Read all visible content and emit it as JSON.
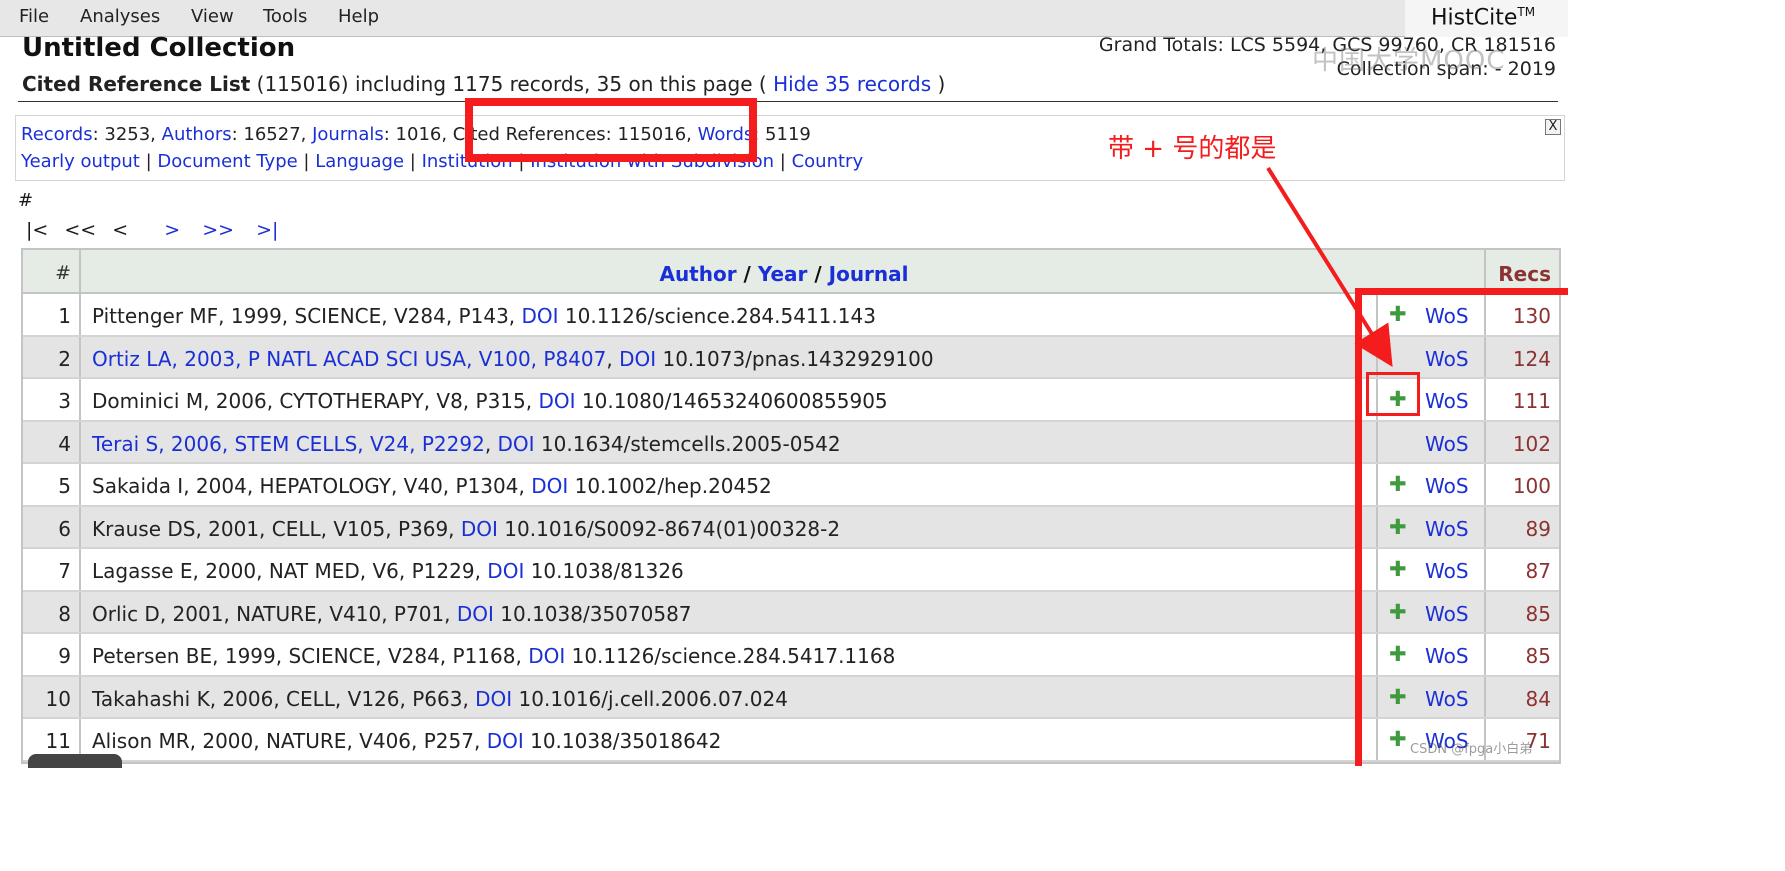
{
  "menu": [
    "File",
    "Analyses",
    "View",
    "Tools",
    "Help"
  ],
  "brand": {
    "name": "HistCite",
    "tm": "TM"
  },
  "collection": {
    "title": "Untitled Collection",
    "grand_totals": "Grand Totals: LCS 5594, GCS 99760, CR 181516",
    "span": "Collection span: - 2019",
    "list_name": "Cited Reference List",
    "list_detail": "(115016) including 1175 records, 35 on this page (",
    "hide_link": "Hide 35 records",
    "close_paren": ")"
  },
  "watermark": "中国大学MOOC",
  "stats": {
    "records_label": "Records",
    "records_value": ": 3253, ",
    "authors_label": "Authors",
    "authors_value": ": 16527, ",
    "journals_label": "Journals",
    "journals_value": ": 1016, ",
    "cited_text": "Cited References: 115016, ",
    "words_label": "Words",
    "words_value": ": 5119"
  },
  "quick_links": [
    "Yearly output",
    "Document Type",
    "Language",
    "Institution",
    "Institution with Subdivision",
    "Country"
  ],
  "close_label": "X",
  "hash": "#",
  "pager": {
    "first": "|<",
    "prev_page": "<<",
    "prev": "<",
    "next": ">",
    "next_page": ">>",
    "last": ">|"
  },
  "table": {
    "col_num": "#",
    "col_author": "Author",
    "col_year": "Year",
    "col_journal": "Journal",
    "sep": " / ",
    "col_recs": "Recs",
    "rows": [
      {
        "n": "1",
        "ref": "Pittenger MF, 1999, SCIENCE, V284, P143, ",
        "ref_link": "",
        "doi": "DOI",
        "doi_value": " 10.1126/science.284.5411.143",
        "plus": "✚",
        "wos": "WoS",
        "recs": "130"
      },
      {
        "n": "2",
        "ref": "",
        "ref_link": "Ortiz LA, 2003, P NATL ACAD SCI USA, V100, P8407",
        "doi": "DOI",
        "doi_value": " 10.1073/pnas.1432929100",
        "plus": "",
        "wos": "WoS",
        "recs": "124"
      },
      {
        "n": "3",
        "ref": "Dominici M, 2006, CYTOTHERAPY, V8, P315, ",
        "ref_link": "",
        "doi": "DOI",
        "doi_value": " 10.1080/14653240600855905",
        "plus": "✚",
        "wos": "WoS",
        "recs": "111"
      },
      {
        "n": "4",
        "ref": "",
        "ref_link": "Terai S, 2006, STEM CELLS, V24, P2292",
        "doi": "DOI",
        "doi_value": " 10.1634/stemcells.2005-0542",
        "plus": "",
        "wos": "WoS",
        "recs": "102"
      },
      {
        "n": "5",
        "ref": "Sakaida I, 2004, HEPATOLOGY, V40, P1304, ",
        "ref_link": "",
        "doi": "DOI",
        "doi_value": " 10.1002/hep.20452",
        "plus": "✚",
        "wos": "WoS",
        "recs": "100"
      },
      {
        "n": "6",
        "ref": "Krause DS, 2001, CELL, V105, P369, ",
        "ref_link": "",
        "doi": "DOI",
        "doi_value": " 10.1016/S0092-8674(01)00328-2",
        "plus": "✚",
        "wos": "WoS",
        "recs": "89"
      },
      {
        "n": "7",
        "ref": "Lagasse E, 2000, NAT MED, V6, P1229, ",
        "ref_link": "",
        "doi": "DOI",
        "doi_value": " 10.1038/81326",
        "plus": "✚",
        "wos": "WoS",
        "recs": "87"
      },
      {
        "n": "8",
        "ref": "Orlic D, 2001, NATURE, V410, P701, ",
        "ref_link": "",
        "doi": "DOI",
        "doi_value": " 10.1038/35070587",
        "plus": "✚",
        "wos": "WoS",
        "recs": "85"
      },
      {
        "n": "9",
        "ref": "Petersen BE, 1999, SCIENCE, V284, P1168, ",
        "ref_link": "",
        "doi": "DOI",
        "doi_value": " 10.1126/science.284.5417.1168",
        "plus": "✚",
        "wos": "WoS",
        "recs": "85"
      },
      {
        "n": "10",
        "ref": "Takahashi K, 2006, CELL, V126, P663, ",
        "ref_link": "",
        "doi": "DOI",
        "doi_value": " 10.1016/j.cell.2006.07.024",
        "plus": "✚",
        "wos": "WoS",
        "recs": "84"
      },
      {
        "n": "11",
        "ref": "Alison MR, 2000, NATURE, V406, P257, ",
        "ref_link": "",
        "doi": "DOI",
        "doi_value": " 10.1038/35018642",
        "plus": "✚",
        "wos": "WoS",
        "recs": "71"
      }
    ]
  },
  "annotation": {
    "text": "带 + 号的都是",
    "color": "#f41c1c"
  },
  "footer_watermark": "CSDN @fpga小白弟"
}
